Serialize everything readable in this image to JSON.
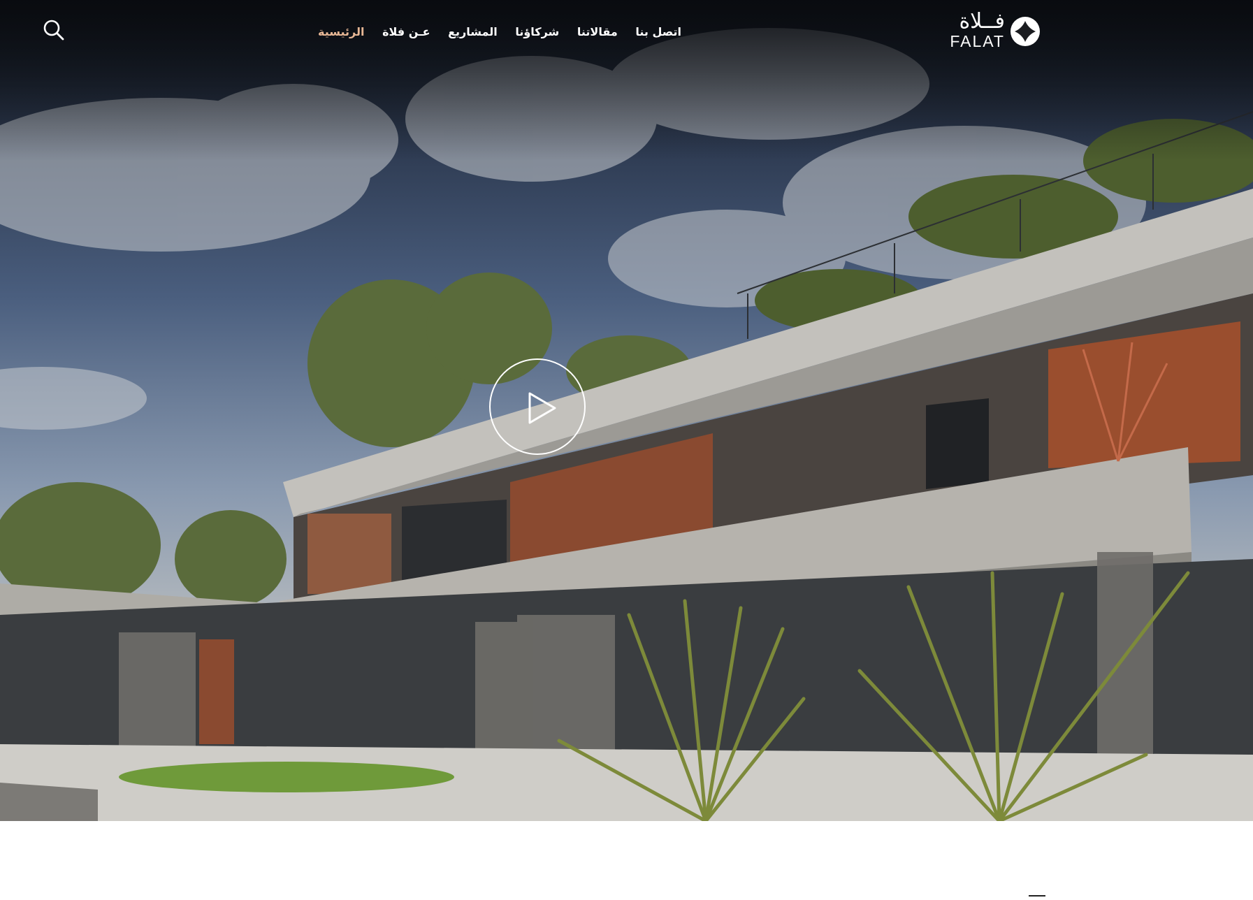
{
  "brand": {
    "name_ar": "فــلاة",
    "name_en": "FALAT",
    "accent": "#e7b795"
  },
  "nav": {
    "items": [
      {
        "label": "الرئيسية",
        "active": true
      },
      {
        "label": "عـن فلاة",
        "active": false
      },
      {
        "label": "المشاريع",
        "active": false
      },
      {
        "label": "شركاؤنا",
        "active": false
      },
      {
        "label": "مقالاتنا",
        "active": false
      },
      {
        "label": "اتصل بنا",
        "active": false
      }
    ]
  },
  "icons": {
    "search": "search-icon",
    "play": "play-icon",
    "logo": "diamond-logo-icon"
  },
  "hero": {
    "media": "modern concrete house with planted roof"
  }
}
